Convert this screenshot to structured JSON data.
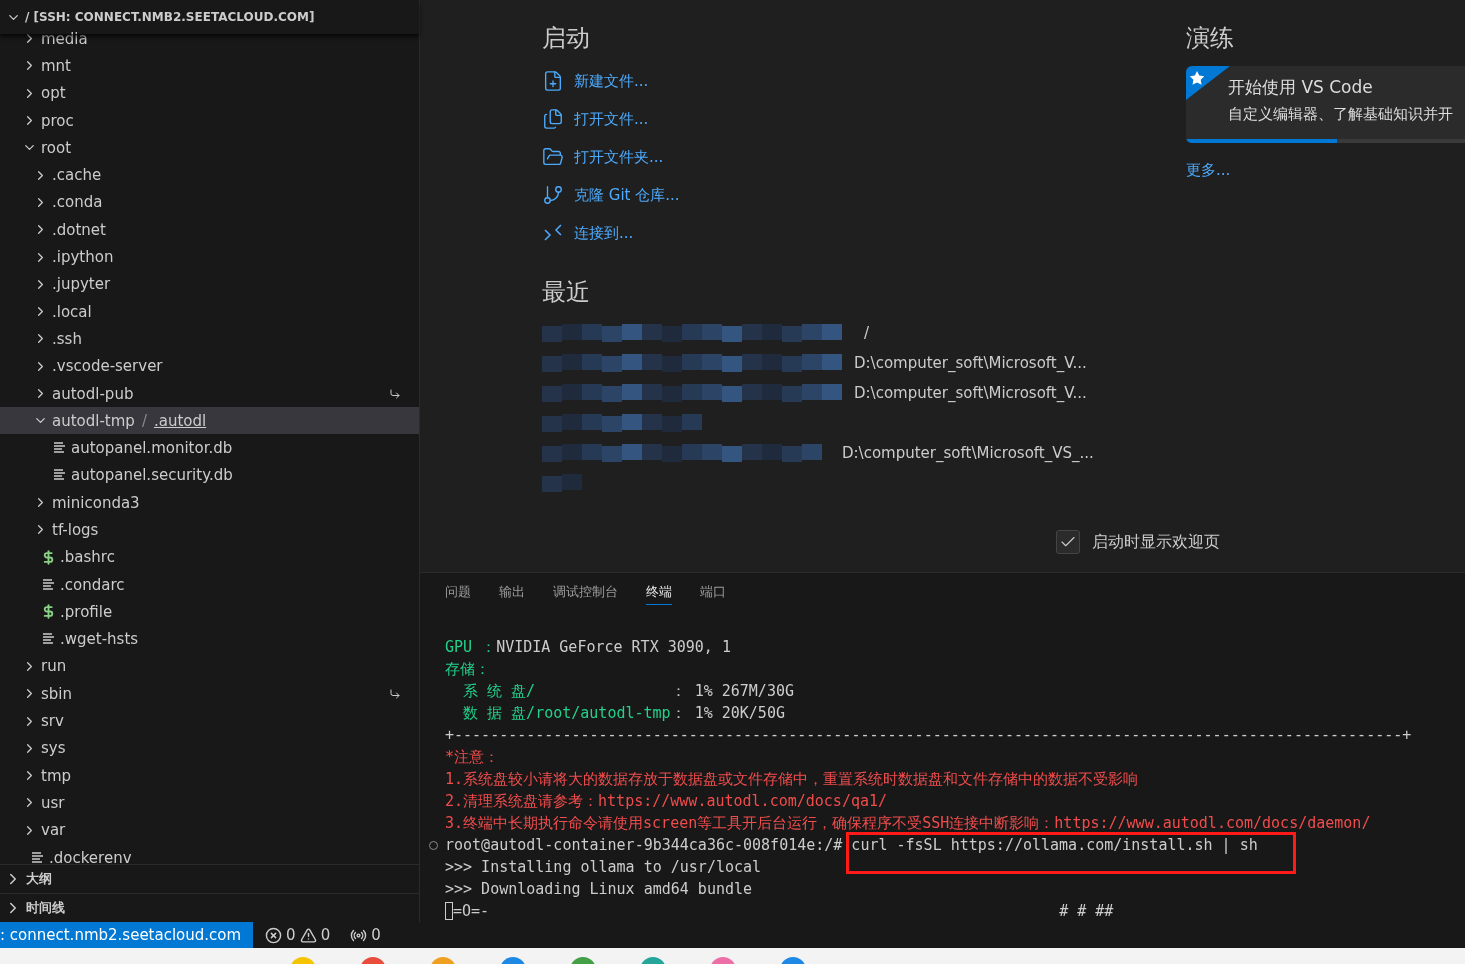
{
  "explorer": {
    "title": "/ [SSH: CONNECT.NMB2.SEETACLOUD.COM]",
    "expanded": true,
    "tree": [
      {
        "name": "media",
        "kind": "folder",
        "expanded": false,
        "selected": false
      },
      {
        "name": "mnt",
        "kind": "folder",
        "expanded": false,
        "selected": false
      },
      {
        "name": "opt",
        "kind": "folder",
        "expanded": false,
        "selected": false
      },
      {
        "name": "proc",
        "kind": "folder",
        "expanded": false,
        "selected": false
      },
      {
        "name": "root",
        "kind": "folder",
        "expanded": true,
        "selected": false,
        "children": [
          {
            "name": ".cache",
            "kind": "folder",
            "expanded": false,
            "selected": false
          },
          {
            "name": ".conda",
            "kind": "folder",
            "expanded": false,
            "selected": false
          },
          {
            "name": ".dotnet",
            "kind": "folder",
            "expanded": false,
            "selected": false
          },
          {
            "name": ".ipython",
            "kind": "folder",
            "expanded": false,
            "selected": false
          },
          {
            "name": ".jupyter",
            "kind": "folder",
            "expanded": false,
            "selected": false
          },
          {
            "name": ".local",
            "kind": "folder",
            "expanded": false,
            "selected": false
          },
          {
            "name": ".ssh",
            "kind": "folder",
            "expanded": false,
            "selected": false
          },
          {
            "name": ".vscode-server",
            "kind": "folder",
            "expanded": false,
            "selected": false
          },
          {
            "name": "autodl-pub",
            "kind": "folder",
            "expanded": false,
            "selected": false,
            "symlink": true
          },
          {
            "name": "autodl-tmp",
            "separator": "/",
            "compact_child": ".autodl",
            "kind": "folder",
            "expanded": true,
            "selected": true,
            "children": [
              {
                "name": "autopanel.monitor.db",
                "kind": "text",
                "selected": false
              },
              {
                "name": "autopanel.security.db",
                "kind": "text",
                "selected": false
              }
            ]
          },
          {
            "name": "miniconda3",
            "kind": "folder",
            "expanded": false,
            "selected": false
          },
          {
            "name": "tf-logs",
            "kind": "folder",
            "expanded": false,
            "selected": false
          },
          {
            "name": ".bashrc",
            "kind": "shell",
            "selected": false
          },
          {
            "name": ".condarc",
            "kind": "text",
            "selected": false
          },
          {
            "name": ".profile",
            "kind": "shell",
            "selected": false
          },
          {
            "name": ".wget-hsts",
            "kind": "text",
            "selected": false
          }
        ]
      },
      {
        "name": "run",
        "kind": "folder",
        "expanded": false,
        "selected": false
      },
      {
        "name": "sbin",
        "kind": "folder",
        "expanded": false,
        "selected": false,
        "symlink": true
      },
      {
        "name": "srv",
        "kind": "folder",
        "expanded": false,
        "selected": false
      },
      {
        "name": "sys",
        "kind": "folder",
        "expanded": false,
        "selected": false
      },
      {
        "name": "tmp",
        "kind": "folder",
        "expanded": false,
        "selected": false
      },
      {
        "name": "usr",
        "kind": "folder",
        "expanded": false,
        "selected": false
      },
      {
        "name": "var",
        "kind": "folder",
        "expanded": false,
        "selected": false
      },
      {
        "name": ".dockerenv",
        "kind": "text",
        "selected": false
      }
    ]
  },
  "side_sections": [
    {
      "label": "大纲",
      "expanded": false
    },
    {
      "label": "时间线",
      "expanded": false
    }
  ],
  "welcome": {
    "start": {
      "heading": "启动",
      "actions": [
        {
          "label": "新建文件...",
          "kind": "new-file"
        },
        {
          "label": "打开文件...",
          "kind": "open-file"
        },
        {
          "label": "打开文件夹...",
          "kind": "open-folder"
        },
        {
          "label": "克隆 Git 仓库...",
          "kind": "clone"
        },
        {
          "label": "连接到...",
          "kind": "remote"
        }
      ]
    },
    "recent": {
      "heading": "最近",
      "items": [
        {
          "kind": "blurred",
          "path": "/"
        },
        {
          "kind": "blurred",
          "path": "D:\\computer_soft\\Microsoft_V..."
        },
        {
          "kind": "blurred",
          "path": "D:\\computer_soft\\Microsoft_V..."
        },
        {
          "kind": "blurred"
        },
        {
          "kind": "blurred",
          "path": "D:\\computer_soft\\Microsoft_VS_..."
        },
        {
          "kind": "blurred"
        }
      ]
    },
    "walkthroughs": {
      "heading": "演练",
      "card": {
        "title": "开始使用 VS Code",
        "description": "自定义编辑器、了解基础知识并开",
        "level": 0.54
      },
      "more": "更多..."
    },
    "show_on_startup": {
      "label": "启动时显示欢迎页",
      "checked": true
    }
  },
  "panel": {
    "tabs": [
      {
        "label": "问题",
        "selected": false
      },
      {
        "label": "输出",
        "selected": false
      },
      {
        "label": "调试控制台",
        "selected": false
      },
      {
        "label": "终端",
        "selected": true
      },
      {
        "label": "端口",
        "selected": false
      }
    ],
    "terminal": [
      {
        "kind": "text",
        "segments": [
          {
            "text": "GPU ：",
            "color": "#23d18b"
          },
          {
            "text": "NVIDIA GeForce RTX 3090, 1",
            "color": "#cccccc"
          }
        ]
      },
      {
        "kind": "text",
        "segments": [
          {
            "text": "存储：",
            "color": "#23d18b"
          }
        ]
      },
      {
        "kind": "text",
        "segments": [
          {
            "text": "  系 统 盘/               ",
            "color": "#23d18b"
          },
          {
            "text": "： 1% 267M/30G",
            "color": "#cccccc"
          }
        ]
      },
      {
        "kind": "text",
        "segments": [
          {
            "text": "  数 据 盘/root/autodl-tmp",
            "color": "#23d18b"
          },
          {
            "text": "： 1% 20K/50G",
            "color": "#cccccc"
          }
        ]
      },
      {
        "kind": "text",
        "segments": [
          {
            "text": "+---------------------------------------------------------------------------------------------------------+",
            "color": "#cccccc"
          }
        ]
      },
      {
        "kind": "text",
        "segments": [
          {
            "text": "*注意：",
            "color": "#f14c4c"
          }
        ]
      },
      {
        "kind": "text",
        "segments": [
          {
            "text": "1.系统盘较小请将大的数据存放于数据盘或文件存储中，重置系统时数据盘和文件存储中的数据不受影响",
            "color": "#f14c4c"
          }
        ]
      },
      {
        "kind": "text",
        "segments": [
          {
            "text": "2.清理系统盘请参考：https://www.autodl.com/docs/qa1/",
            "color": "#f14c4c"
          }
        ]
      },
      {
        "kind": "text",
        "segments": [
          {
            "text": "3.终端中长期执行命令请使用screen等工具开后台运行，确保程序不受SSH连接中断影响：https://www.autodl.com/docs/daemon/",
            "color": "#f14c4c"
          }
        ]
      },
      {
        "kind": "prompt",
        "prompt": "root@autodl-container-9b344ca36c-008f014e:/#",
        "command": "curl -fsSL https://ollama.com/install.sh | sh",
        "highlighted": true
      },
      {
        "kind": "text",
        "segments": [
          {
            "text": ">>> Installing ollama to /usr/local",
            "color": "#cccccc"
          }
        ]
      },
      {
        "kind": "text",
        "segments": [
          {
            "text": ">>> Downloading Linux amd64 bundle",
            "color": "#cccccc"
          }
        ]
      },
      {
        "kind": "progress",
        "spinner": "=O=-",
        "bar": "# # ##"
      }
    ]
  },
  "status_bar": {
    "remote": ": connect.nmb2.seetacloud.com",
    "errors": "0",
    "warnings": "0",
    "ports": "0"
  }
}
